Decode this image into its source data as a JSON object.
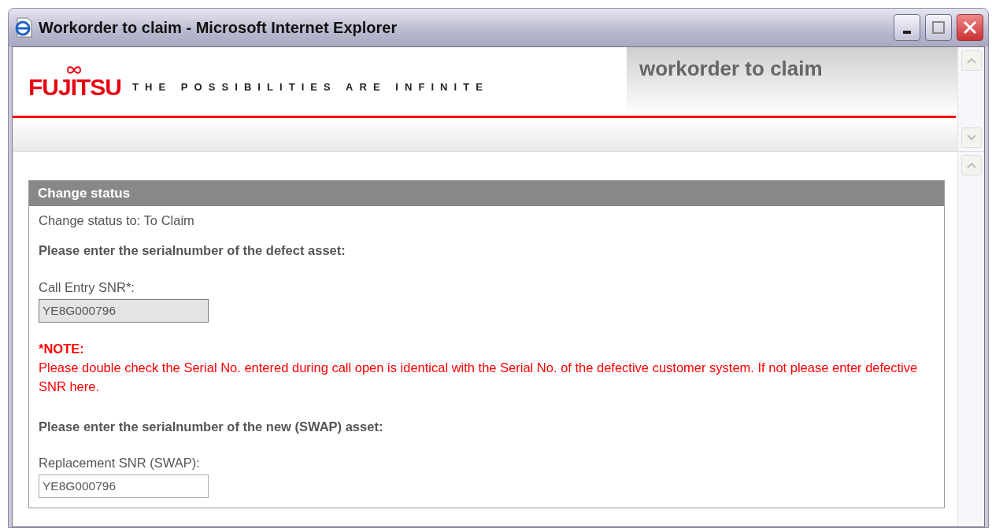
{
  "window": {
    "title": "Workorder to claim - Microsoft Internet Explorer"
  },
  "header": {
    "logo": "FUJITSU",
    "tagline": "THE POSSIBILITIES ARE INFINITE",
    "page_title": "workorder to claim"
  },
  "panel": {
    "title": "Change status",
    "status_line": "Change status to: To Claim",
    "items": [
      {
        "kind": "heading",
        "text": "Please enter the serialnumber of the defect asset:"
      },
      {
        "kind": "field",
        "label": "Call Entry SNR*:",
        "value": "YE8G000796",
        "disabled": true
      },
      {
        "kind": "note",
        "title": "*NOTE:",
        "text": "Please double check the Serial No. entered during call open is identical with the Serial No. of the defective customer system. If not please enter defective SNR here."
      },
      {
        "kind": "heading",
        "text": "Please enter the serialnumber of the new (SWAP) asset:"
      },
      {
        "kind": "field",
        "label": "Replacement SNR (SWAP):",
        "value": "YE8G000796",
        "disabled": false
      }
    ]
  }
}
